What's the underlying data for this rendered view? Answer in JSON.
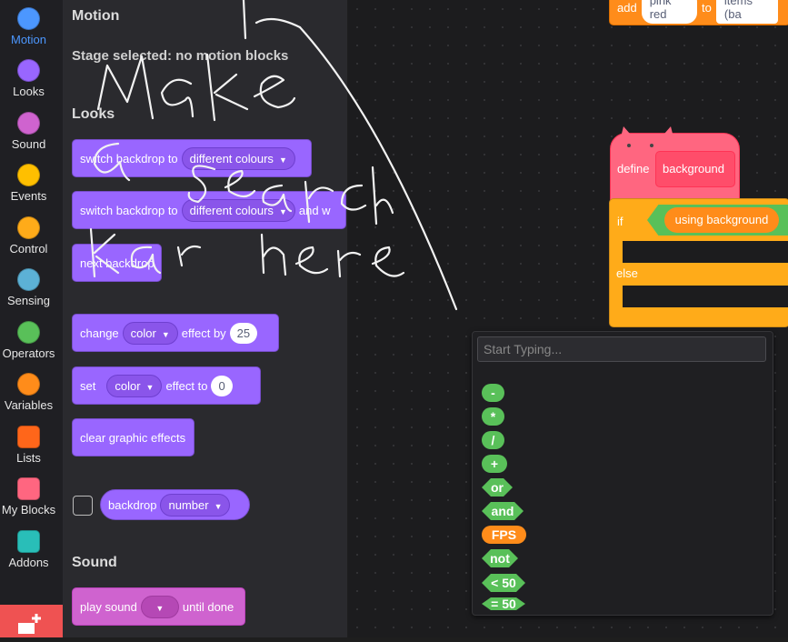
{
  "categories": [
    {
      "label": "Motion",
      "color": "#4c97ff",
      "icon": "motion-icon",
      "active": true
    },
    {
      "label": "Looks",
      "color": "#9966ff",
      "icon": "looks-icon"
    },
    {
      "label": "Sound",
      "color": "#cf63cf",
      "icon": "sound-icon"
    },
    {
      "label": "Events",
      "color": "#ffbf00",
      "icon": "events-icon"
    },
    {
      "label": "Control",
      "color": "#ffab19",
      "icon": "control-icon"
    },
    {
      "label": "Sensing",
      "color": "#5cb1d6",
      "icon": "sensing-icon"
    },
    {
      "label": "Operators",
      "color": "#59c059",
      "icon": "operators-icon"
    },
    {
      "label": "Variables",
      "color": "#ff8c1a",
      "icon": "variables-icon"
    },
    {
      "label": "Lists",
      "color": "#ff661a",
      "icon": "lists-icon"
    },
    {
      "label": "My Blocks",
      "color": "#ff6680",
      "icon": "myblocks-icon"
    },
    {
      "label": "Addons",
      "color": "#29beb8",
      "icon": "addons-icon"
    }
  ],
  "palette": {
    "motion_heading": "Motion",
    "motion_note": "Stage selected: no motion blocks",
    "looks_heading": "Looks",
    "sound_heading": "Sound",
    "blocks": {
      "switch_backdrop": "switch backdrop to",
      "backdrop_value": "different colours",
      "and_wait": "and w",
      "next_backdrop": "next backdrop",
      "change": "change",
      "effect_by": "effect by",
      "color": "color",
      "change_value": "25",
      "set": "set",
      "effect_to": "effect to",
      "set_value": "0",
      "clear_effects": "clear graphic effects",
      "backdrop": "backdrop",
      "number": "number",
      "play_sound": "play sound",
      "until_done": "until done"
    }
  },
  "workspace": {
    "add": "add",
    "pink_red": "pink red",
    "to": "to",
    "items": "items (ba",
    "define": "define",
    "background": "background",
    "if": "if",
    "using_background": "using background",
    "else": "else"
  },
  "search": {
    "placeholder": "Start Typing...",
    "results": [
      "-",
      "*",
      "/",
      "+",
      "or",
      "and",
      "FPS",
      "not",
      "< 50",
      "= 50"
    ]
  },
  "annotation": {
    "text": "Make a search bar here"
  }
}
